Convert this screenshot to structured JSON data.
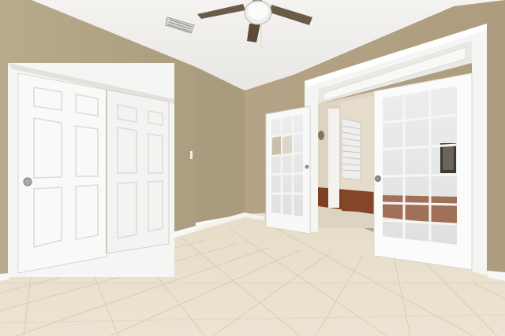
{
  "scene": {
    "description_type": "interior-photo",
    "objects": [
      "ceiling-fan",
      "air-vent",
      "closet-bifold-doors",
      "french-doors",
      "tile-floor",
      "hardwood-floor-next-room",
      "window-with-blinds",
      "wall-picture"
    ]
  },
  "colors": {
    "wall": "#b8a98c",
    "wall_shadow": "#a8987b",
    "ceiling": "#f2f1ee",
    "floor": "#e8ddc9",
    "trim": "#f7f7f5",
    "wood_floor": "#7a3f22"
  }
}
